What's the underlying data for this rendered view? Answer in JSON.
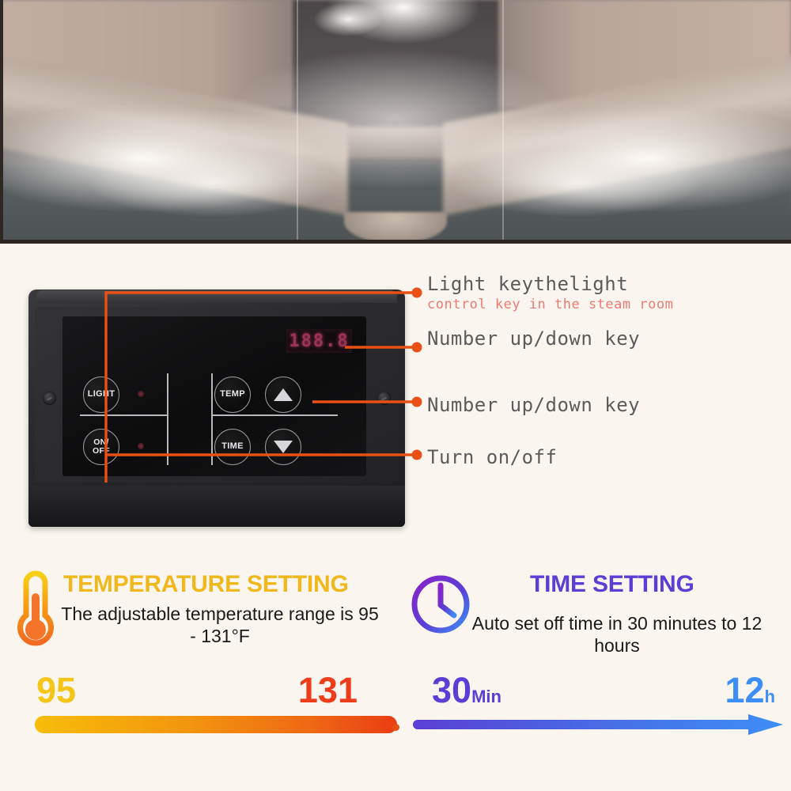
{
  "photo": {
    "alt": "steam-room-interior-with-steam",
    "scene": "steam room with wooden benches on both sides and dense steam"
  },
  "device": {
    "name": "steam generator control panel",
    "led_display": "188.8",
    "buttons": [
      {
        "key": "light",
        "label": "LIGHT"
      },
      {
        "key": "onoff",
        "label_line1": "ON/",
        "label_line2": "OFF"
      },
      {
        "key": "temp",
        "label": "TEMP"
      },
      {
        "key": "time",
        "label": "TIME"
      },
      {
        "key": "up",
        "label": "▲"
      },
      {
        "key": "down",
        "label": "▼"
      }
    ]
  },
  "callouts": [
    {
      "id": "light-key",
      "title": "Light keythelight",
      "subtitle": "control key in the steam room"
    },
    {
      "id": "number-up-down-top",
      "title": "Number up/down key",
      "subtitle": ""
    },
    {
      "id": "number-up-down-bottom",
      "title": "Number up/down key",
      "subtitle": ""
    },
    {
      "id": "turn-on-off",
      "title": "Turn on/off",
      "subtitle": ""
    }
  ],
  "temperature": {
    "icon": "thermometer-icon",
    "heading": "TEMPERATURE SETTING",
    "description": "The adjustable temperature range is 95 - 131°F",
    "min_value": "95",
    "max_value": "131",
    "min_unit": "",
    "max_unit": "",
    "heading_color": "#f0b81c",
    "min_color": "#f5c518",
    "max_color": "#ee3d1a",
    "bar_from": "#f7bc08",
    "bar_to": "#ea3d14"
  },
  "time": {
    "icon": "clock-icon",
    "heading": "TIME SETTING",
    "description": "Auto set off time in 30 minutes to 12 hours",
    "min_value": "30",
    "max_value": "12",
    "min_unit": "Min",
    "max_unit": "h",
    "heading_color": "#5b3fd4",
    "min_color": "#5b3fd4",
    "max_color": "#3d8ef7",
    "bar_from": "#5b3fd4",
    "bar_to": "#3d8ef7"
  },
  "theme": {
    "background": "#faf6ef",
    "leader_color": "#ea4f16"
  }
}
